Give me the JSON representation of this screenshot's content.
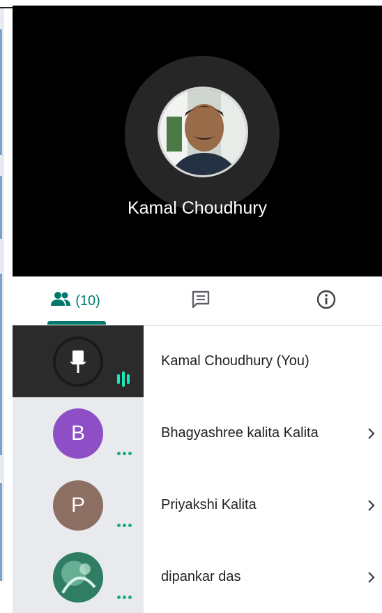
{
  "video": {
    "participant_name": "Kamal Choudhury"
  },
  "tabs": {
    "people_count": "(10)"
  },
  "participants": [
    {
      "name": "Kamal Choudhury (You)",
      "initial": "",
      "avatar_color": "#2b2b2b",
      "pinned": true,
      "speaking": true
    },
    {
      "name": "Bhagyashree kalita Kalita",
      "initial": "B",
      "avatar_color": "#8e4ec6",
      "pinned": false,
      "speaking": false
    },
    {
      "name": "Priyakshi Kalita",
      "initial": "P",
      "avatar_color": "#8d6e63",
      "pinned": false,
      "speaking": false
    },
    {
      "name": "dipankar das",
      "initial": "",
      "avatar_color": "#3e8e73",
      "pinned": false,
      "speaking": false
    }
  ],
  "colors": {
    "accent": "#00796b",
    "speaking": "#1de9b6",
    "status_dots": "#1aa68a"
  },
  "icons": [
    "people-icon",
    "chat-icon",
    "info-icon",
    "chevron-right-icon",
    "pin-icon",
    "audio-level-icon",
    "more-dots-icon"
  ]
}
